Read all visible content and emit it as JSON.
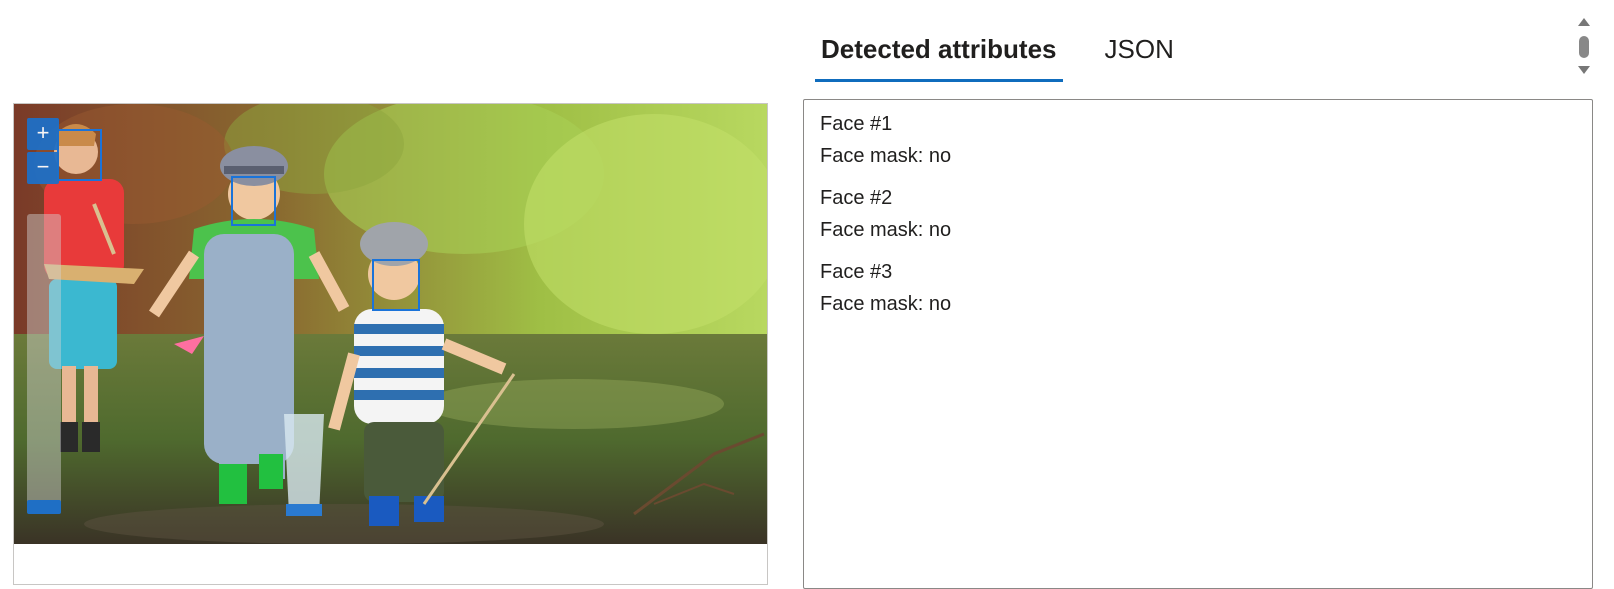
{
  "tabs": [
    {
      "label": "Detected attributes",
      "active": true
    },
    {
      "label": "JSON",
      "active": false
    }
  ],
  "image_viewer": {
    "zoom_in_label": "+",
    "zoom_out_label": "−",
    "face_box_color": "#1a73d9"
  },
  "faces": [
    {
      "title": "Face #1",
      "attribute": "Face mask: no"
    },
    {
      "title": "Face #2",
      "attribute": "Face mask: no"
    },
    {
      "title": "Face #3",
      "attribute": "Face mask: no"
    }
  ],
  "colors": {
    "accent": "#0f6cbd",
    "zoom_control": "#1f6fc5"
  }
}
